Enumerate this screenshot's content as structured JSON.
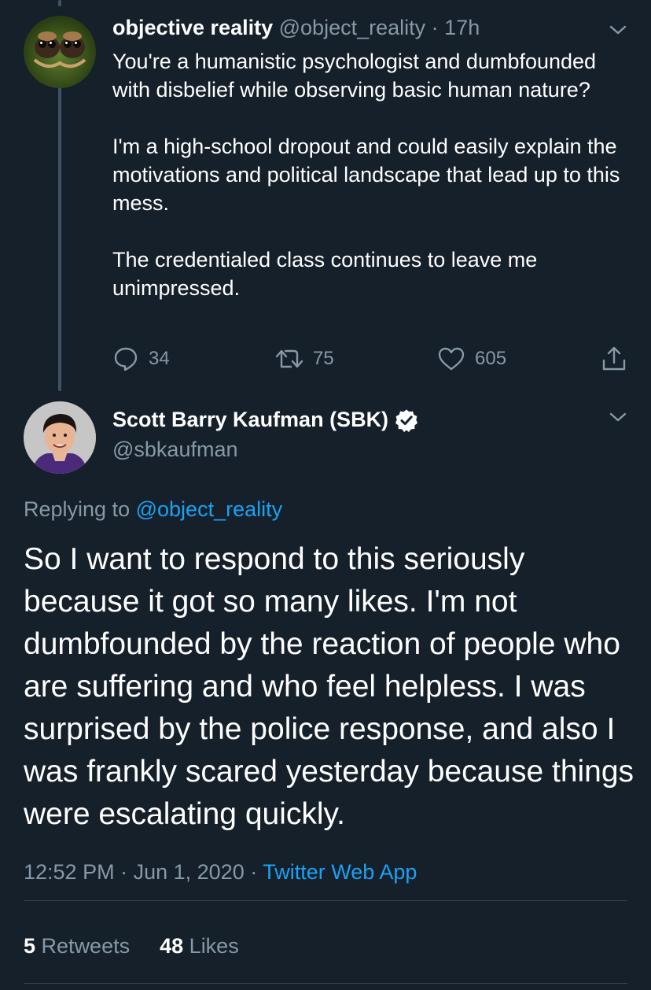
{
  "tweet1": {
    "display_name": "objective reality",
    "handle": "@object_reality",
    "separator": "·",
    "time": "17h",
    "paragraphs": [
      "You're a humanistic psychologist and dumbfounded with disbelief while observing basic human nature?",
      "I'm a high-school dropout and could easily explain the motivations and political landscape that lead up to this mess.",
      "The credentialed class continues to leave me unimpressed."
    ],
    "replies": "34",
    "retweets": "75",
    "likes": "605"
  },
  "tweet2": {
    "display_name": "Scott Barry Kaufman (SBK)",
    "handle": "@sbkaufman",
    "replying_prefix": "Replying to",
    "replying_to": "@object_reality",
    "text": "So I want to respond to this seriously because it got so many likes. I'm not dumbfounded by the reaction of people who are suffering and who feel helpless. I was surprised by the police response, and also I was frankly scared yesterday because things were escalating quickly.",
    "time": "12:52 PM",
    "sep1": "·",
    "date": "Jun 1, 2020",
    "sep2": "·",
    "source": "Twitter Web App",
    "retweet_count": "5",
    "retweet_label": "Retweets",
    "like_count": "48",
    "like_label": "Likes"
  },
  "colors": {
    "background": "#15202b",
    "muted": "#8899a6",
    "link": "#1da1f2",
    "divider": "#38444d"
  },
  "icons": [
    "reply-icon",
    "retweet-icon",
    "like-icon",
    "share-icon",
    "chevron-down-icon",
    "verified-badge-icon"
  ]
}
